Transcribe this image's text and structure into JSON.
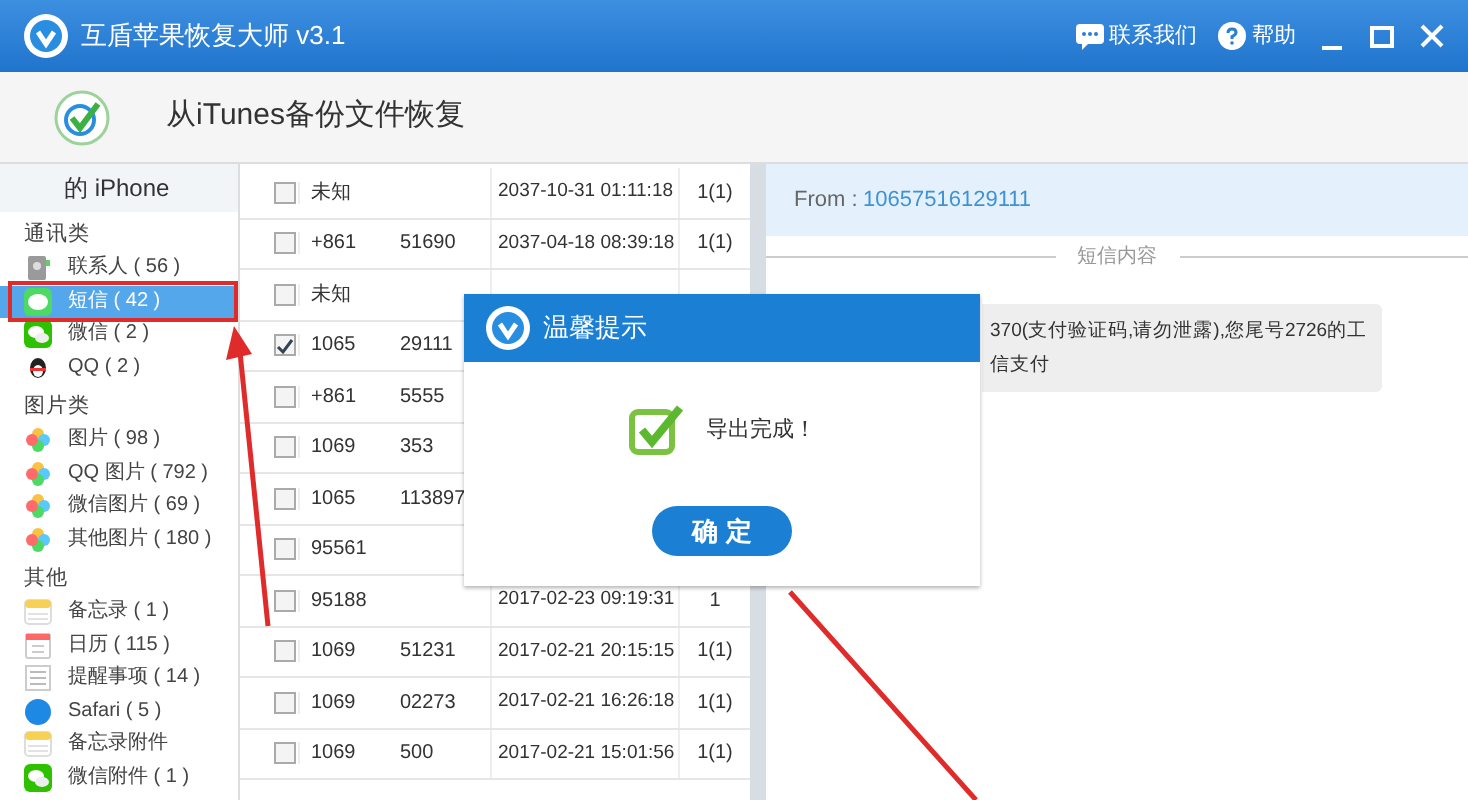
{
  "window": {
    "title": "互盾苹果恢复大师 v3.1",
    "actions": [
      {
        "kind": "contact",
        "label": "联系我们"
      },
      {
        "kind": "help",
        "label": "帮助"
      }
    ]
  },
  "toolbar": {
    "title": "从iTunes备份文件恢复"
  },
  "sidebar": {
    "device": "的 iPhone",
    "groups": [
      {
        "title": "通讯类",
        "items": [
          {
            "kind": "contacts",
            "label": "联系人 ( 56 )",
            "selected": false
          },
          {
            "kind": "sms",
            "label": "短信 ( 42 )",
            "selected": true
          },
          {
            "kind": "wechat",
            "label": "微信 ( 2 )",
            "selected": false
          },
          {
            "kind": "qq",
            "label": "QQ ( 2 )",
            "selected": false
          }
        ]
      },
      {
        "title": "图片类",
        "items": [
          {
            "kind": "photos",
            "label": "图片 ( 98 )",
            "selected": false
          },
          {
            "kind": "photos",
            "label": "QQ 图片 ( 792 )",
            "selected": false
          },
          {
            "kind": "photos",
            "label": "微信图片 ( 69 )",
            "selected": false
          },
          {
            "kind": "photos",
            "label": "其他图片 ( 180 )",
            "selected": false
          }
        ]
      },
      {
        "title": "其他",
        "items": [
          {
            "kind": "notes",
            "label": "备忘录 ( 1 )",
            "selected": false
          },
          {
            "kind": "calendar",
            "label": "日历 ( 115 )",
            "selected": false
          },
          {
            "kind": "reminders",
            "label": "提醒事项 ( 14 )",
            "selected": false
          },
          {
            "kind": "safari",
            "label": "Safari ( 5 )",
            "selected": false
          },
          {
            "kind": "notes",
            "label": "备忘录附件",
            "selected": false
          },
          {
            "kind": "wechat",
            "label": "微信附件 ( 1 )",
            "selected": false
          }
        ]
      }
    ]
  },
  "table": {
    "rows": [
      {
        "checked": false,
        "column_2": "未知",
        "date": "2037-10-31 01:11:18",
        "count": "1(1)"
      },
      {
        "checked": false,
        "column_2": "+861",
        "column_3": "51690",
        "date": "2037-04-18 08:39:18",
        "count": "1(1)"
      },
      {
        "checked": false,
        "column_2": "未知"
      },
      {
        "checked": true,
        "column_2": "1065",
        "column_3": "29111"
      },
      {
        "checked": false,
        "column_2": "+861",
        "column_3": "5555"
      },
      {
        "checked": false,
        "column_2": "1069",
        "column_3": "353"
      },
      {
        "checked": false,
        "column_2": "1065",
        "column_3": "113897"
      },
      {
        "checked": false,
        "column_2": "95561"
      },
      {
        "checked": false,
        "column_2": "95188",
        "date": "2017-02-23 09:19:31",
        "count": "1"
      },
      {
        "checked": false,
        "column_2": "1069",
        "column_3": "51231",
        "date": "2017-02-21 20:15:15",
        "count": "1(1)"
      },
      {
        "checked": false,
        "column_2": "1069",
        "column_3": "02273",
        "date": "2017-02-21 16:26:18",
        "count": "1(1)"
      },
      {
        "checked": false,
        "column_2": "1069",
        "column_3": "500",
        "date": "2017-02-21 15:01:56",
        "count": "1(1)"
      }
    ]
  },
  "detail": {
    "from_label": "From :",
    "from": "10657516129111",
    "section": "短信内容",
    "message_lines": [
      "370(支付验证码,请勿泄露),您尾号2726的工",
      "信支付"
    ]
  },
  "dialog": {
    "title": "温馨提示",
    "message": "导出完成！",
    "button": "确 定"
  }
}
